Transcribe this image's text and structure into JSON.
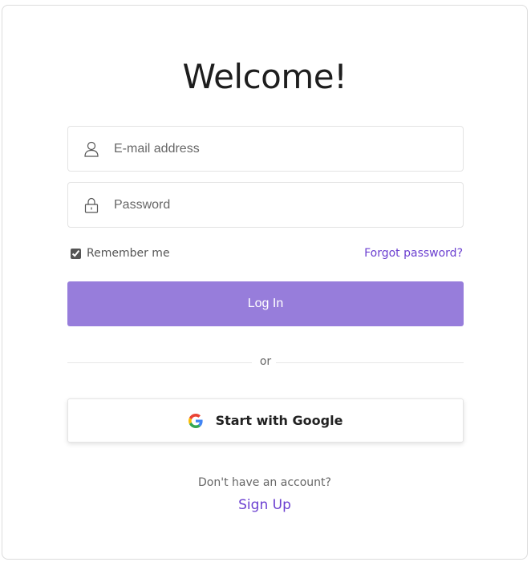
{
  "login": {
    "title": "Welcome!",
    "email": {
      "placeholder": "E-mail address",
      "value": ""
    },
    "password": {
      "placeholder": "Password",
      "value": ""
    },
    "remember_label": "Remember me",
    "remember_checked": true,
    "forgot_label": "Forgot password?",
    "login_label": "Log In",
    "divider_label": "or",
    "google_label": "Start with Google",
    "no_account_label": "Don't have an account?",
    "signup_label": "Sign Up"
  },
  "colors": {
    "accent": "#6b3fd0",
    "login_button": "#977ddb",
    "border": "#e3e3e3"
  },
  "icons": {
    "email": "user-icon",
    "password": "lock-icon",
    "google": "google-icon"
  }
}
